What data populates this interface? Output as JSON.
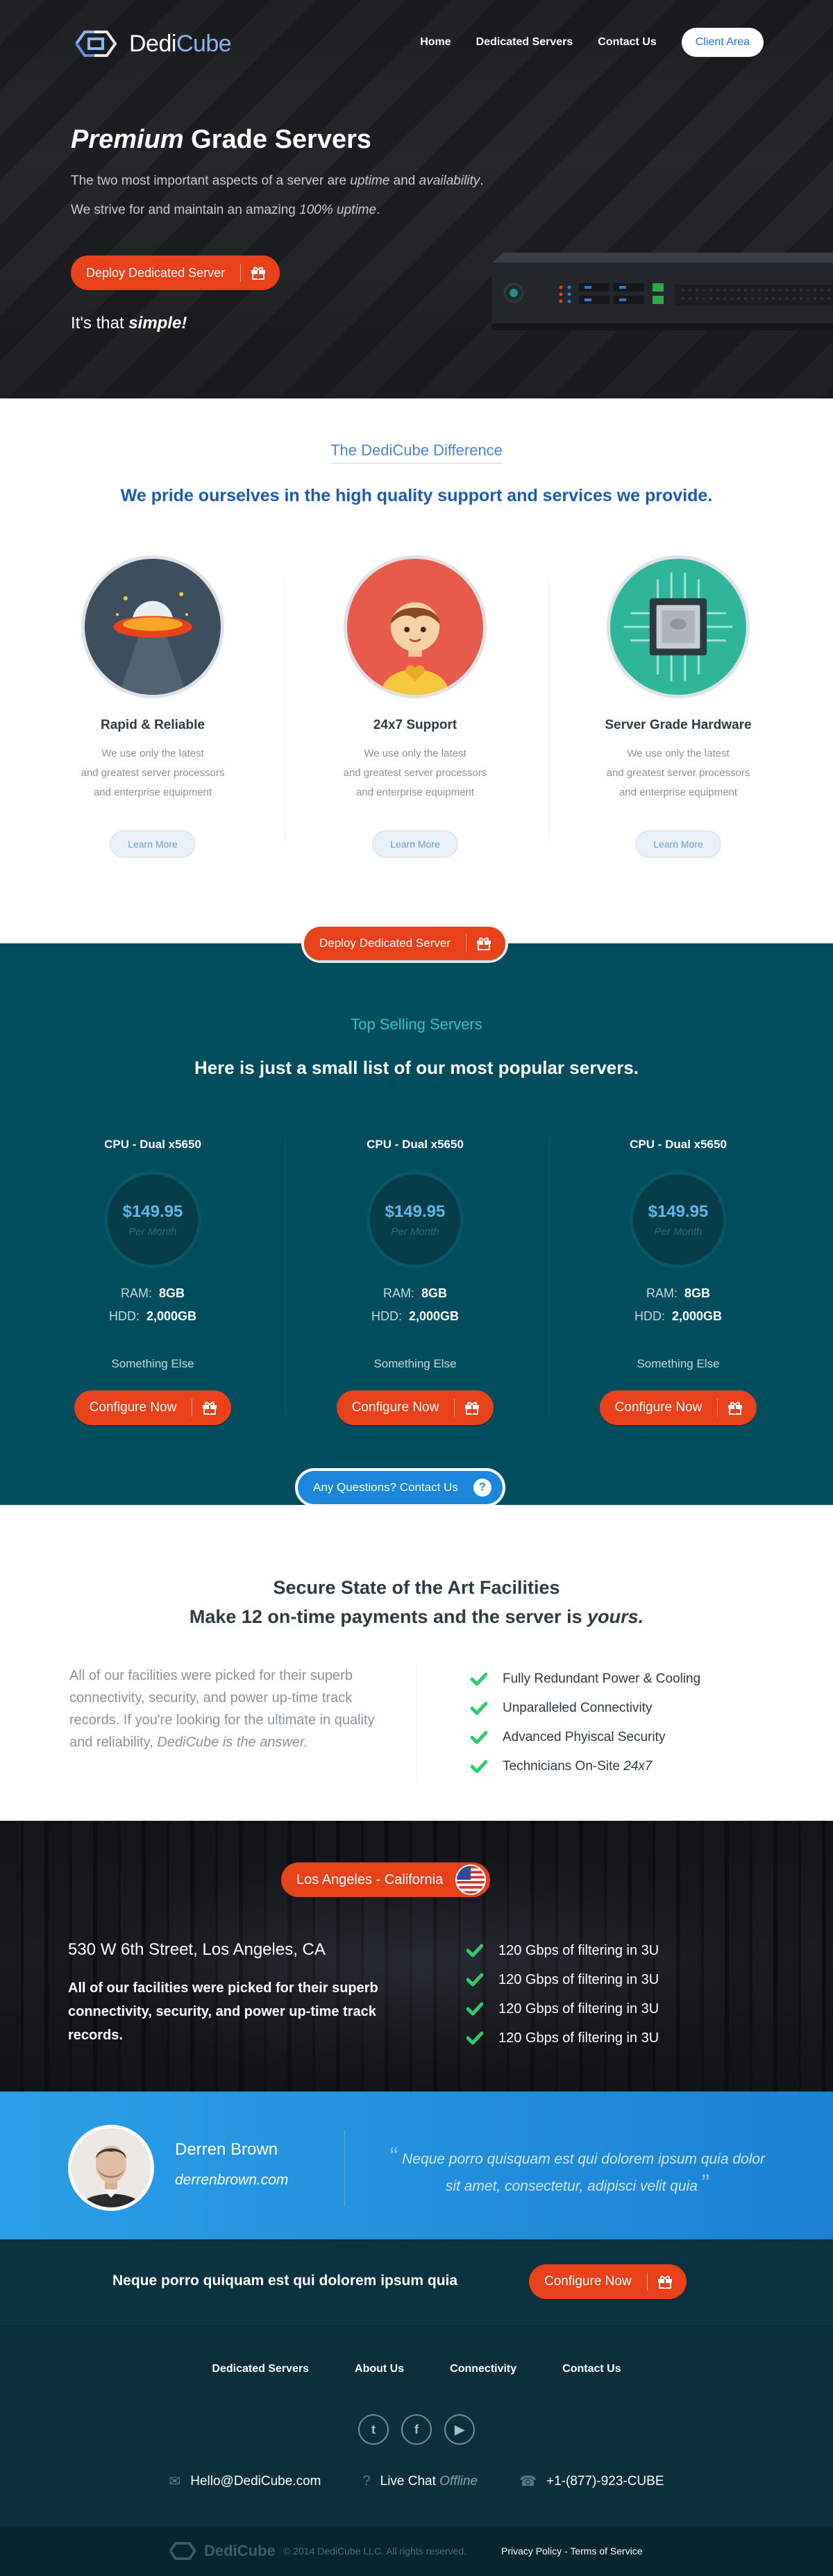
{
  "brand": {
    "name_part1": "Dedi",
    "name_part2": "Cube"
  },
  "nav": {
    "home": "Home",
    "dedicated": "Dedicated Servers",
    "contact": "Contact Us",
    "client_area": "Client Area"
  },
  "hero": {
    "title_em": "Premium",
    "title_rest": " Grade Servers",
    "line1_a": "The two most important aspects of a server are ",
    "line1_b": "uptime",
    "line1_c": " and ",
    "line1_d": "availability",
    "line1_e": ".",
    "line2_a": "We strive for and maintain an amazing ",
    "line2_b": "100% uptime",
    "line2_c": ".",
    "deploy_label": "Deploy Dedicated Server",
    "simple_a": "It's that ",
    "simple_b": "simple!"
  },
  "difference": {
    "eyebrow": "The DediCube Difference",
    "headline": "We pride ourselves in the high quality support and services we provide.",
    "features": [
      {
        "title": "Rapid & Reliable",
        "line1": "We use only the latest",
        "line2": "and greatest server processors",
        "line3": "and enterprise equipment",
        "cta": "Learn More",
        "icon": "ufo-icon"
      },
      {
        "title": "24x7 Support",
        "line1": "We use only the latest",
        "line2": "and greatest server processors",
        "line3": "and enterprise equipment",
        "cta": "Learn More",
        "icon": "support-person-icon"
      },
      {
        "title": "Server Grade Hardware",
        "line1": "We use only the latest",
        "line2": "and greatest server processors",
        "line3": "and enterprise equipment",
        "cta": "Learn More",
        "icon": "cpu-chip-icon"
      }
    ]
  },
  "selling": {
    "deploy_label": "Deploy Dedicated Server",
    "eyebrow": "Top Selling Servers",
    "headline": "Here is just a small list of our most popular servers.",
    "plans": [
      {
        "cpu": "CPU - Dual x5650",
        "price": "$149.95",
        "per": "Per Month",
        "ram_label": "RAM:",
        "ram": "8GB",
        "hdd_label": "HDD:",
        "hdd": "2,000GB",
        "extra": "Something Else",
        "cta": "Configure Now"
      },
      {
        "cpu": "CPU - Dual x5650",
        "price": "$149.95",
        "per": "Per Month",
        "ram_label": "RAM:",
        "ram": "8GB",
        "hdd_label": "HDD:",
        "hdd": "2,000GB",
        "extra": "Something Else",
        "cta": "Configure Now"
      },
      {
        "cpu": "CPU - Dual x5650",
        "price": "$149.95",
        "per": "Per Month",
        "ram_label": "RAM:",
        "ram": "8GB",
        "hdd_label": "HDD:",
        "hdd": "2,000GB",
        "extra": "Something Else",
        "cta": "Configure Now"
      }
    ],
    "questions_label": "Any Questions? Contact Us",
    "questions_icon": "?"
  },
  "facilities": {
    "heading1": "Secure State of the Art Facilities",
    "heading2_a": "Make 12 on-time payments and the server is ",
    "heading2_b": "yours.",
    "para": "All of our facilities were picked for their superb connectivity, security, and power up-time track records. If you're looking for the ultimate in quality and reliability, ",
    "para_em": "DediCube is the answer.",
    "checks": [
      "Fully Redundant Power & Cooling",
      "Unparalleled Connectivity",
      "Advanced Phyiscal Security"
    ],
    "check4_a": "Technicians On-Site ",
    "check4_b": "24x7"
  },
  "datacenter": {
    "location": "Los Angeles - California",
    "address": "530 W 6th Street, Los Angeles, CA",
    "para": "All of our facilities were picked for their superb connectivity, security, and power up-time track records.",
    "checks": [
      "120 Gbps of filtering in 3U",
      "120 Gbps of filtering in 3U",
      "120 Gbps of filtering in 3U",
      "120 Gbps of filtering in 3U"
    ]
  },
  "testimonial": {
    "name": "Derren Brown",
    "site": "derrenbrown.com",
    "open_quote": "“",
    "quote": "Neque porro quisquam est qui dolorem ipsum quia dolor sit amet, consectetur, adipisci velit quia",
    "close_quote": "”"
  },
  "cta": {
    "text": "Neque porro quiquam est qui dolorem ipsum quia",
    "button": "Configure Now"
  },
  "footer": {
    "nav": [
      "Dedicated Servers",
      "About Us",
      "Connectivity",
      "Contact Us"
    ],
    "social": {
      "twitter": "t",
      "facebook": "f",
      "youtube": "▶"
    },
    "email": "Hello@DediCube.com",
    "chat_a": "Live Chat ",
    "chat_b": "Offline",
    "phone": "+1-(877)-923-CUBE",
    "logo_part1": "Dedi",
    "logo_part2": "Cube",
    "copyright": "© 2014 DediCube LLC. All rights reserved.",
    "privacy": "Privacy Policy",
    "sep": " - ",
    "terms": "Terms of Service"
  },
  "colors": {
    "orange": "#e9411a",
    "teal": "#004e5d",
    "blue": "#1b86da",
    "green_check": "#2ecc71",
    "heading_blue": "#1b5bb5"
  }
}
